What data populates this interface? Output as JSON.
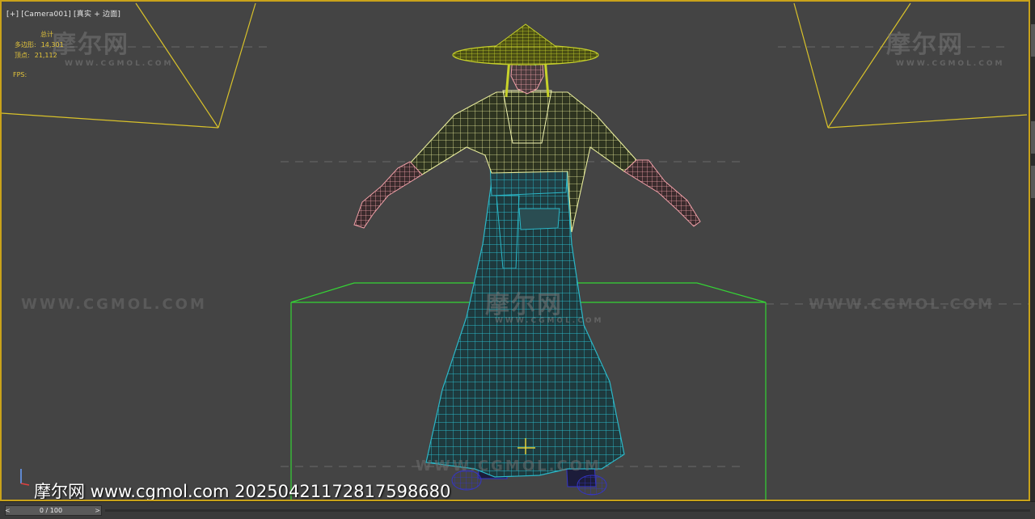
{
  "viewport": {
    "label_plus": "[+]",
    "label_camera": "[Camera001]",
    "label_mode": "[真实 + 边面]"
  },
  "stats": {
    "header": "总计",
    "polys_label": "多边形:",
    "polys_value": "14,301",
    "verts_label": "顶点:",
    "verts_value": "21,112",
    "fps_label": "FPS:"
  },
  "watermarks": {
    "logo": "摩尔网",
    "sub": "WWW.CGMOL.COM",
    "url": "WWW.CGMOL.COM"
  },
  "bottom_watermark": "摩尔网 www.cgmol.com 20250421172817598680",
  "timeline": {
    "frame_text": "0 / 100",
    "next_arrow": ">",
    "prev_arrow": "<"
  },
  "colors": {
    "viewport_border": "#c9a21a",
    "stats_text": "#e3c43a",
    "camera_lines": "#d9c22a",
    "bounding_box": "#35d435",
    "robe_wire": "#2bb8c8",
    "shirt_wire": "#e6ea9a",
    "hands_wire": "#f0a0a8",
    "hat_wire": "#c8d22a"
  },
  "icons": {
    "axis": "axis-gizmo-icon"
  }
}
